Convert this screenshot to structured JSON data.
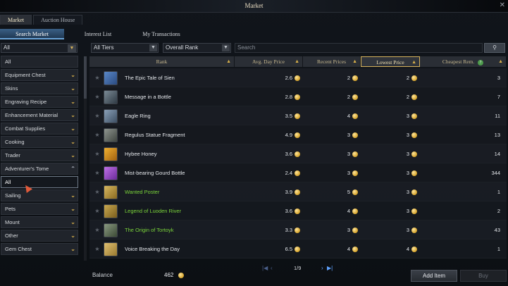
{
  "window": {
    "title": "Market",
    "close_icon": "close-icon"
  },
  "top_tabs": [
    {
      "label": "Market"
    },
    {
      "label": "Auction House"
    }
  ],
  "sub_tabs": [
    {
      "label": "Search Market"
    },
    {
      "label": "Interest List"
    },
    {
      "label": "My Transactions"
    }
  ],
  "sidebar": {
    "filter_value": "All",
    "categories": [
      {
        "label": "All"
      },
      {
        "label": "Equipment Chest"
      },
      {
        "label": "Skins"
      },
      {
        "label": "Engraving Recipe"
      },
      {
        "label": "Enhancement Material"
      },
      {
        "label": "Combat Supplies"
      },
      {
        "label": "Cooking"
      },
      {
        "label": "Trader"
      },
      {
        "label": "Adventurer's Tome"
      },
      {
        "label": "All"
      },
      {
        "label": "Sailing"
      },
      {
        "label": "Pets"
      },
      {
        "label": "Mount"
      },
      {
        "label": "Other"
      },
      {
        "label": "Gem Chest"
      }
    ]
  },
  "filters": {
    "tier": "All Tiers",
    "rank": "Overall Rank",
    "search_placeholder": "Search"
  },
  "table": {
    "headers": {
      "rank": "Rank",
      "avg": "Avg. Day Price",
      "recent": "Recent Prices",
      "lowest": "Lowest Price",
      "cheapest": "Cheapest Rem."
    },
    "rows": [
      {
        "name": "The Epic Tale of Sien",
        "avg": "2.6",
        "recent": "2",
        "lowest": "2",
        "cheapest": "3"
      },
      {
        "name": "Message in a Bottle",
        "avg": "2.8",
        "recent": "2",
        "lowest": "2",
        "cheapest": "7"
      },
      {
        "name": "Eagle Ring",
        "avg": "3.5",
        "recent": "4",
        "lowest": "3",
        "cheapest": "11"
      },
      {
        "name": "Regulus Statue Fragment",
        "avg": "4.9",
        "recent": "3",
        "lowest": "3",
        "cheapest": "13"
      },
      {
        "name": "Hybee Honey",
        "avg": "3.6",
        "recent": "3",
        "lowest": "3",
        "cheapest": "14"
      },
      {
        "name": "Mist-bearing Gourd Bottle",
        "avg": "2.4",
        "recent": "3",
        "lowest": "3",
        "cheapest": "344"
      },
      {
        "name": "Wanted Poster",
        "avg": "3.9",
        "recent": "5",
        "lowest": "3",
        "cheapest": "1"
      },
      {
        "name": "Legend of Luoden River",
        "avg": "3.6",
        "recent": "4",
        "lowest": "3",
        "cheapest": "2"
      },
      {
        "name": "The Origin of Tortoyk",
        "avg": "3.3",
        "recent": "3",
        "lowest": "3",
        "cheapest": "43"
      },
      {
        "name": "Voice Breaking the Day",
        "avg": "6.5",
        "recent": "4",
        "lowest": "4",
        "cheapest": "1"
      }
    ]
  },
  "pager": {
    "text": "1/9"
  },
  "footer": {
    "balance_label": "Balance",
    "balance_value": "462",
    "add_item": "Add Item",
    "buy": "Buy"
  }
}
